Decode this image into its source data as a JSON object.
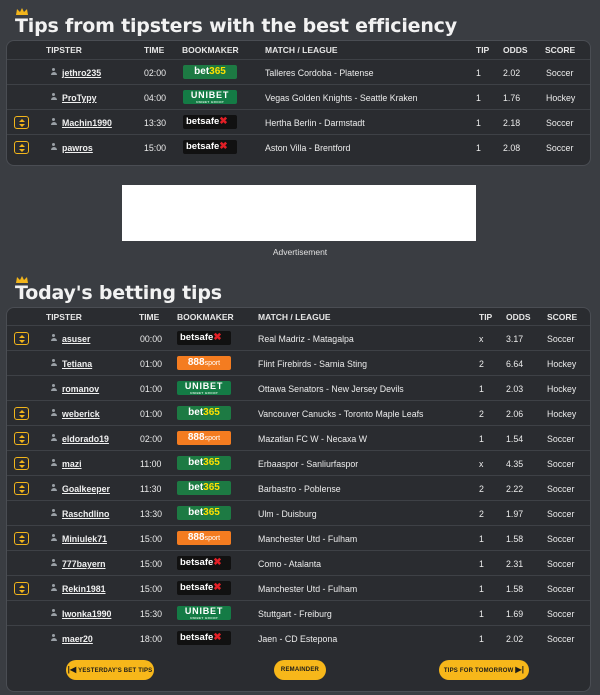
{
  "section1": {
    "title": "Tips from tipsters with the best efficiency",
    "headers": [
      "TIPSTER",
      "TIME",
      "BOOKMAKER",
      "MATCH / LEAGUE",
      "TIP",
      "ODDS",
      "SCORE"
    ],
    "rows": [
      {
        "expand": false,
        "tipster": "jethro235",
        "time": "02:00",
        "bookmaker": "bet365",
        "match": "Talleres Cordoba - Platense",
        "tip": "1",
        "odds": "2.02",
        "score": "Soccer"
      },
      {
        "expand": false,
        "tipster": "ProTypy",
        "time": "04:00",
        "bookmaker": "unibet",
        "match": "Vegas Golden Knights - Seattle Kraken",
        "tip": "1",
        "odds": "1.76",
        "score": "Hockey"
      },
      {
        "expand": true,
        "tipster": "Machin1990",
        "time": "13:30",
        "bookmaker": "betsafe",
        "match": "Hertha Berlin - Darmstadt",
        "tip": "1",
        "odds": "2.18",
        "score": "Soccer"
      },
      {
        "expand": true,
        "tipster": "pawros",
        "time": "15:00",
        "bookmaker": "betsafe",
        "match": "Aston Villa - Brentford",
        "tip": "1",
        "odds": "2.08",
        "score": "Soccer"
      }
    ]
  },
  "ad": {
    "label": "Advertisement"
  },
  "section2": {
    "title": "Today's betting tips",
    "headers": [
      "TIPSTER",
      "TIME",
      "BOOKMAKER",
      "MATCH / LEAGUE",
      "TIP",
      "ODDS",
      "SCORE"
    ],
    "rows": [
      {
        "expand": true,
        "tipster": "asuser",
        "time": "00:00",
        "bookmaker": "betsafe",
        "match": "Real Madriz - Matagalpa",
        "tip": "x",
        "odds": "3.17",
        "score": "Soccer"
      },
      {
        "expand": false,
        "tipster": "Tetiana",
        "time": "01:00",
        "bookmaker": "888",
        "match": "Flint Firebirds - Sarnia Sting",
        "tip": "2",
        "odds": "6.64",
        "score": "Hockey"
      },
      {
        "expand": false,
        "tipster": "romanov",
        "time": "01:00",
        "bookmaker": "unibet",
        "match": "Ottawa Senators - New Jersey Devils",
        "tip": "1",
        "odds": "2.03",
        "score": "Hockey"
      },
      {
        "expand": true,
        "tipster": "weberick",
        "time": "01:00",
        "bookmaker": "bet365",
        "match": "Vancouver Canucks - Toronto Maple Leafs",
        "tip": "2",
        "odds": "2.06",
        "score": "Hockey"
      },
      {
        "expand": true,
        "tipster": "eldorado19",
        "time": "02:00",
        "bookmaker": "888",
        "match": "Mazatlan FC W - Necaxa W",
        "tip": "1",
        "odds": "1.54",
        "score": "Soccer"
      },
      {
        "expand": true,
        "tipster": "mazi",
        "time": "11:00",
        "bookmaker": "bet365",
        "match": "Erbaaspor - Sanliurfaspor",
        "tip": "x",
        "odds": "4.35",
        "score": "Soccer"
      },
      {
        "expand": true,
        "tipster": "Goalkeeper",
        "time": "11:30",
        "bookmaker": "bet365",
        "match": "Barbastro - Poblense",
        "tip": "2",
        "odds": "2.22",
        "score": "Soccer"
      },
      {
        "expand": false,
        "tipster": "Raschdlino",
        "time": "13:30",
        "bookmaker": "bet365",
        "match": "Ulm - Duisburg",
        "tip": "2",
        "odds": "1.97",
        "score": "Soccer"
      },
      {
        "expand": true,
        "tipster": "Miniulek71",
        "time": "15:00",
        "bookmaker": "888",
        "match": "Manchester Utd - Fulham",
        "tip": "1",
        "odds": "1.58",
        "score": "Soccer"
      },
      {
        "expand": false,
        "tipster": "777bayern",
        "time": "15:00",
        "bookmaker": "betsafe",
        "match": "Como - Atalanta",
        "tip": "1",
        "odds": "2.31",
        "score": "Soccer"
      },
      {
        "expand": true,
        "tipster": "Rekin1981",
        "time": "15:00",
        "bookmaker": "betsafe",
        "match": "Manchester Utd - Fulham",
        "tip": "1",
        "odds": "1.58",
        "score": "Soccer"
      },
      {
        "expand": false,
        "tipster": "Iwonka1990",
        "time": "15:30",
        "bookmaker": "unibet",
        "match": "Stuttgart - Freiburg",
        "tip": "1",
        "odds": "1.69",
        "score": "Soccer"
      },
      {
        "expand": false,
        "tipster": "maer20",
        "time": "18:00",
        "bookmaker": "betsafe",
        "match": "Jaen - CD Estepona",
        "tip": "1",
        "odds": "2.02",
        "score": "Soccer"
      }
    ]
  },
  "bookmaker_labels": {
    "bet365_a": "bet",
    "bet365_b": "365",
    "unibet": "UNIBET",
    "unibet_sub": "UNIBET GROUP",
    "betsafe": "betsafe",
    "betsafe_x": "✖",
    "b888_a": "888",
    "b888_b": "sport"
  },
  "buttons": {
    "yesterday": "YESTERDAY'S BET TIPS",
    "remainder": "REMAINDER",
    "tomorrow": "TIPS FOR TOMORROW"
  },
  "colors": {
    "accent": "#f7b71a",
    "background": "#3a3d42",
    "panel": "#2a2c30"
  }
}
